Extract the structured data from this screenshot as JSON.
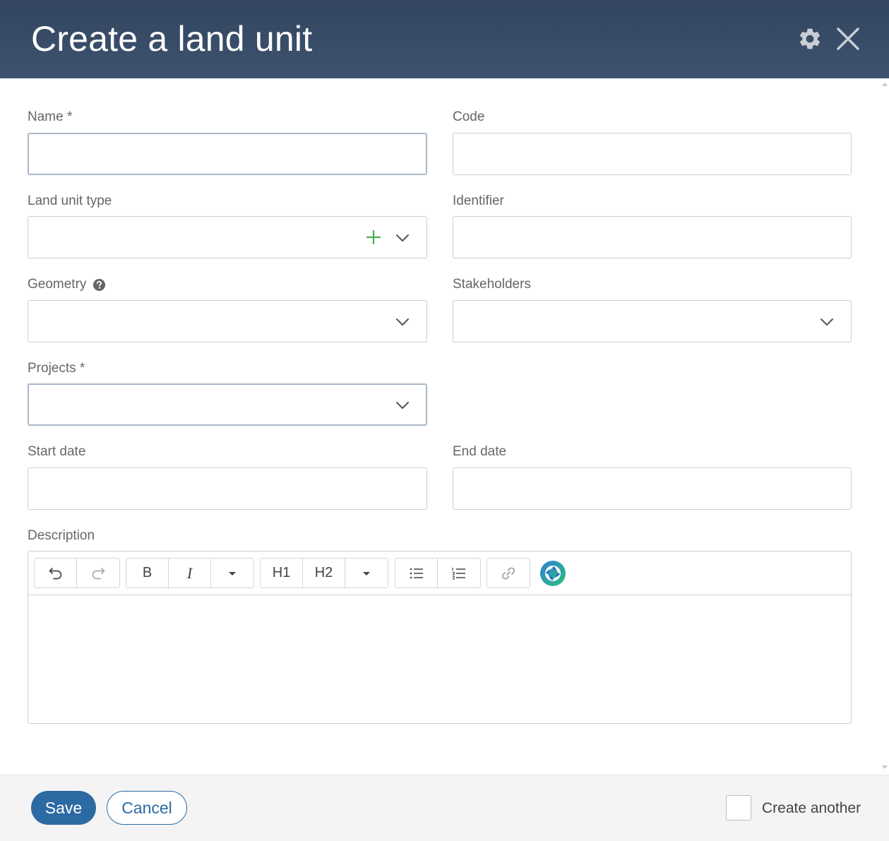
{
  "dialog": {
    "title": "Create a land unit"
  },
  "fields": {
    "name": {
      "label": "Name *",
      "value": "",
      "placeholder": ""
    },
    "code": {
      "label": "Code",
      "value": "",
      "placeholder": ""
    },
    "land_unit_type": {
      "label": "Land unit type",
      "value": ""
    },
    "identifier": {
      "label": "Identifier",
      "value": "",
      "placeholder": ""
    },
    "geometry": {
      "label": "Geometry",
      "value": ""
    },
    "stakeholders": {
      "label": "Stakeholders",
      "value": ""
    },
    "projects": {
      "label": "Projects *",
      "value": ""
    },
    "start_date": {
      "label": "Start date",
      "value": "",
      "placeholder": ""
    },
    "end_date": {
      "label": "End date",
      "value": "",
      "placeholder": ""
    },
    "description": {
      "label": "Description",
      "value": ""
    }
  },
  "editor_toolbar": {
    "bold": "B",
    "italic": "I",
    "heading1": "H1",
    "heading2": "H2"
  },
  "footer": {
    "save_label": "Save",
    "cancel_label": "Cancel",
    "create_another_label": "Create another",
    "create_another_checked": false
  },
  "colors": {
    "header_bg": "#33455f",
    "primary": "#2c6aa3",
    "add_green": "#4caf50"
  },
  "icons": {
    "settings": "gear-icon",
    "close": "close-icon",
    "help": "question-circle-icon",
    "add": "plus-icon",
    "dropdown": "chevron-down-icon"
  }
}
